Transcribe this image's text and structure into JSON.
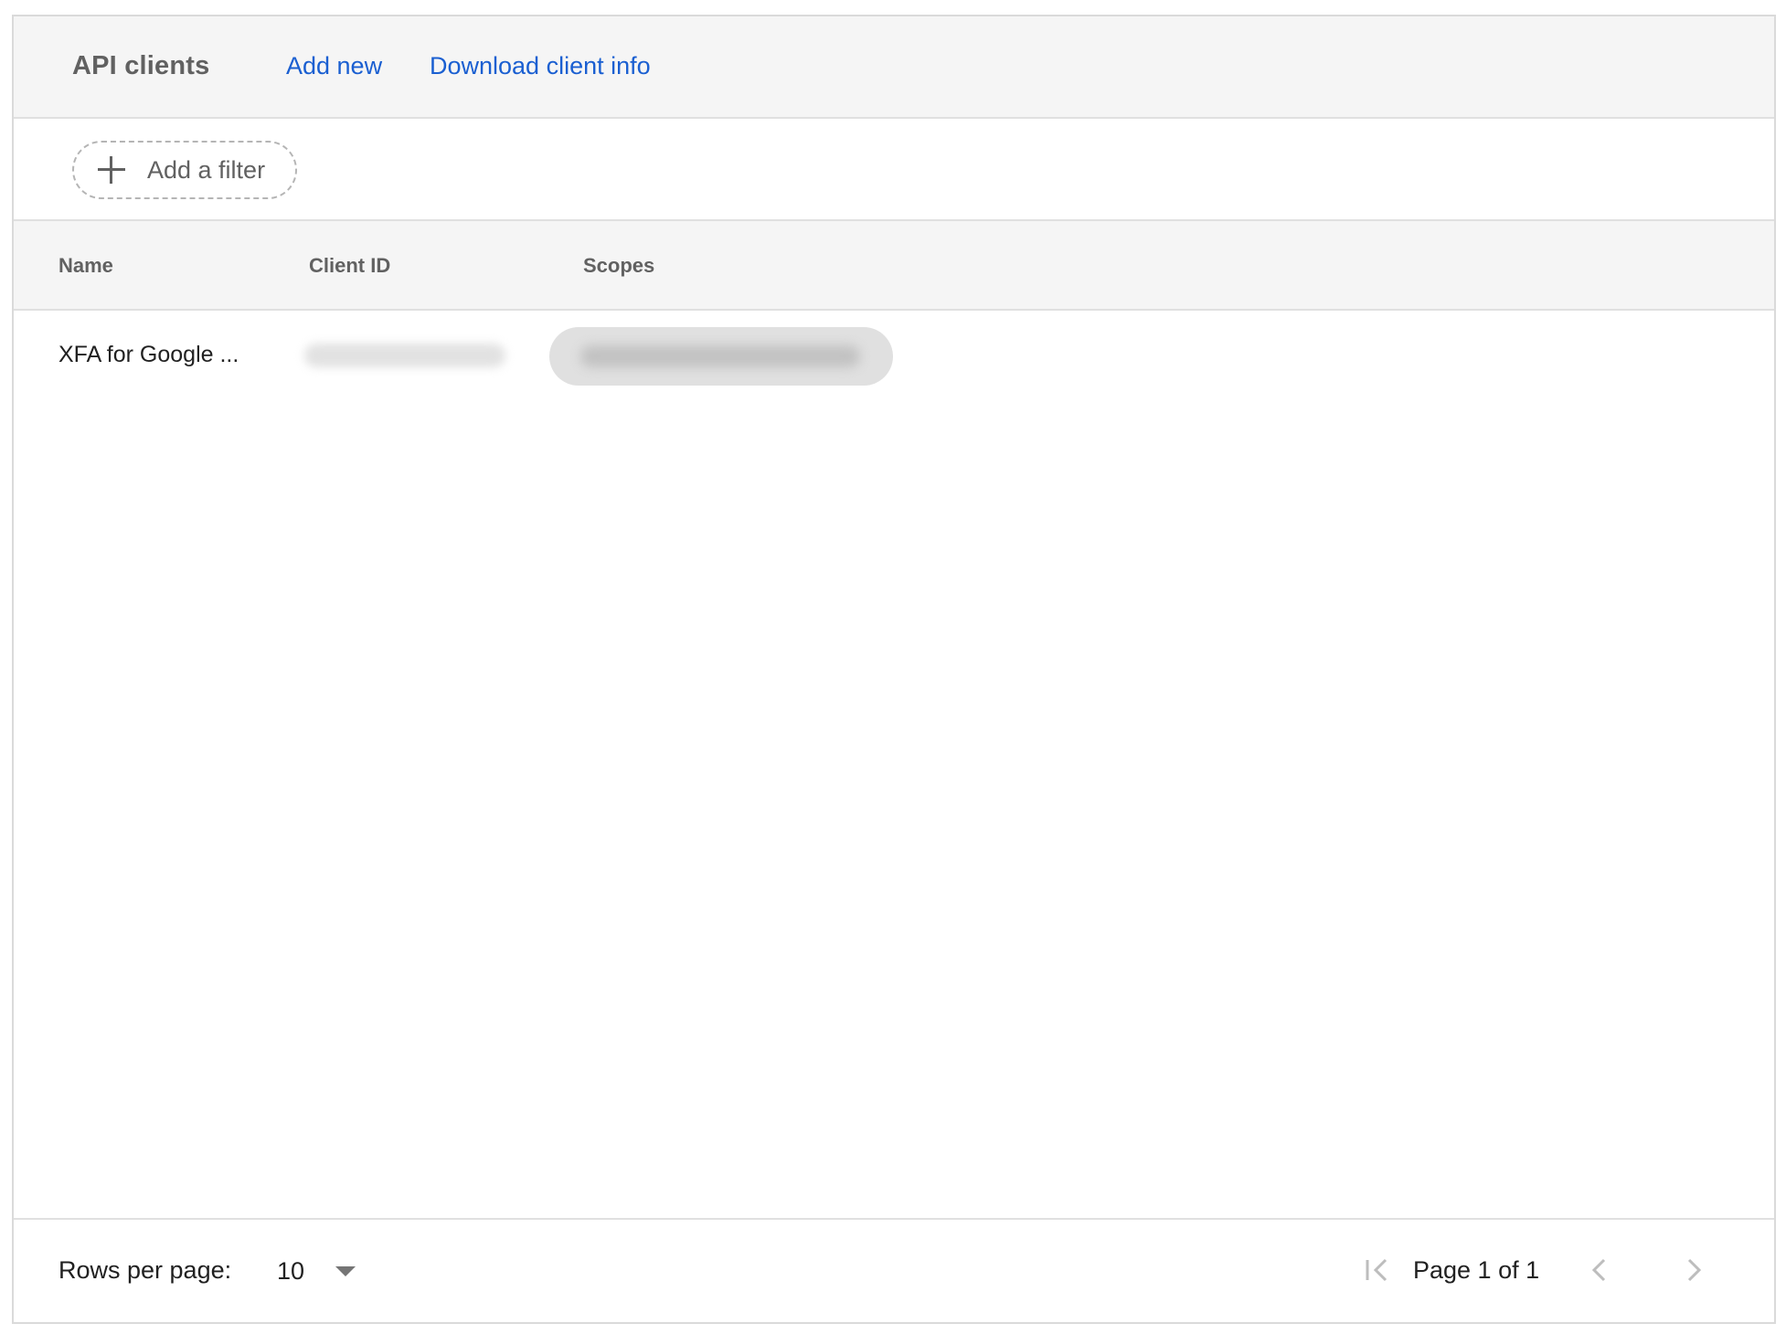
{
  "header": {
    "title": "API clients",
    "add_new_label": "Add new",
    "download_label": "Download client info"
  },
  "filter": {
    "add_filter_label": "Add a filter"
  },
  "table": {
    "columns": [
      "Name",
      "Client ID",
      "Scopes"
    ],
    "rows": [
      {
        "name": "XFA for Google ...",
        "client_id": "",
        "scopes": ""
      }
    ]
  },
  "pagination": {
    "rows_per_page_label": "Rows per page:",
    "rows_per_page_value": "10",
    "page_info": "Page 1 of 1"
  },
  "icons": {
    "add_filter": "plus-icon",
    "rows_dropdown": "caret-down-icon",
    "first_page": "first-page-icon",
    "prev_page": "chevron-left-icon",
    "next_page": "chevron-right-icon"
  },
  "colors": {
    "link": "#1a5fd1",
    "header_bg": "#f5f5f5",
    "border": "#e0e0e0",
    "disabled_icon": "#bdbdbd"
  }
}
